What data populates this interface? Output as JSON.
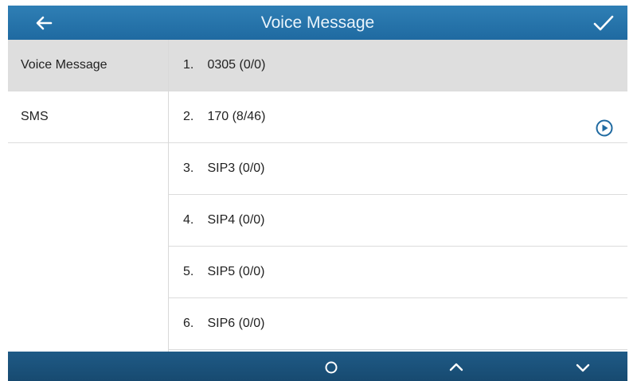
{
  "header": {
    "title": "Voice Message",
    "back_icon": "arrow-left-icon",
    "confirm_icon": "checkmark-icon"
  },
  "sidebar": {
    "items": [
      {
        "label": "Voice Message",
        "active": true
      },
      {
        "label": "SMS",
        "active": false
      }
    ]
  },
  "list": {
    "rows": [
      {
        "index": "1.",
        "text": "0305 (0/0)",
        "selected": true,
        "play": false
      },
      {
        "index": "2.",
        "text": "170 (8/46)",
        "selected": false,
        "play": true
      },
      {
        "index": "3.",
        "text": "SIP3 (0/0)",
        "selected": false,
        "play": false
      },
      {
        "index": "4.",
        "text": "SIP4 (0/0)",
        "selected": false,
        "play": false
      },
      {
        "index": "5.",
        "text": "SIP5 (0/0)",
        "selected": false,
        "play": false
      },
      {
        "index": "6.",
        "text": "SIP6 (0/0)",
        "selected": false,
        "play": false
      }
    ]
  },
  "footer": {
    "buttons": [
      "home-circle-icon",
      "chevron-up-icon",
      "chevron-down-icon"
    ]
  },
  "colors": {
    "header_bg": "#2675ad",
    "footer_bg": "#1b5279",
    "selected_row": "#dedede",
    "accent": "#1f6aa1"
  }
}
